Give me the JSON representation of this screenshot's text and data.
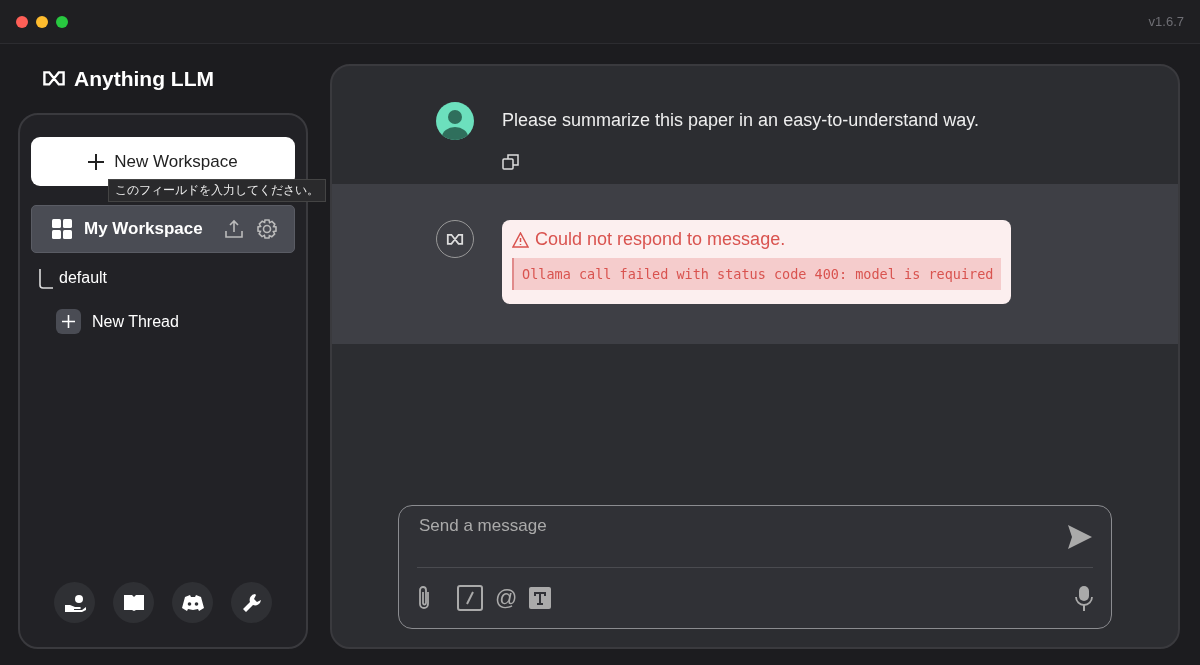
{
  "window": {
    "version": "v1.6.7"
  },
  "sidebar": {
    "app_name": "Anything LLM",
    "new_workspace_button": "New Workspace",
    "tooltip": "このフィールドを入力してください。",
    "workspaces": [
      {
        "name": "My Workspace",
        "selected": true,
        "threads": [
          {
            "name": "default"
          }
        ]
      }
    ],
    "new_thread_button": "New Thread"
  },
  "chat": {
    "messages": [
      {
        "kind": "user",
        "text": "Please summarize this paper in an easy-to-understand way."
      },
      {
        "kind": "error",
        "title": "Could not respond to message.",
        "detail": "Ollama call failed with status code 400: model is required"
      }
    ],
    "composer": {
      "placeholder": "Send a message",
      "mention_symbol": "@"
    }
  }
}
